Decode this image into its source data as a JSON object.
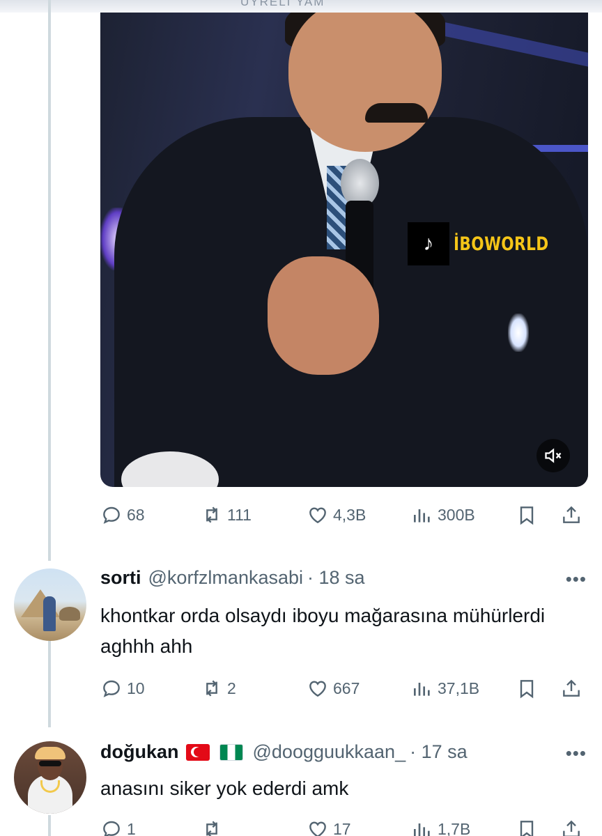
{
  "header": {
    "partial_text": "UYRELI YAM"
  },
  "video": {
    "watermark_text": "İBOWORLD",
    "watermark_icon": "tiktok-icon",
    "mute_icon": "volume-muted-icon"
  },
  "main_post": {
    "actions": {
      "replies": "68",
      "reposts": "111",
      "likes": "4,3B",
      "views": "300B"
    }
  },
  "replies": [
    {
      "name": "sorti",
      "handle": "@korfzlmankasabi",
      "time": "· 18 sa",
      "text": "khontkar orda olsaydı iboyu mağarasına mühürlerdi aghhh ahh",
      "actions": {
        "replies": "10",
        "reposts": "2",
        "likes": "667",
        "views": "37,1B"
      }
    },
    {
      "name": "doğukan",
      "flags": [
        "flag-turkey-icon",
        "flag-nigeria-icon"
      ],
      "handle": "@doogguukkaan_",
      "time": "· 17 sa",
      "text": "anasını siker yok ederdi amk",
      "actions": {
        "replies": "1",
        "reposts": "",
        "likes": "17",
        "views": "1,7B"
      }
    }
  ],
  "colors": {
    "text": "#0f1419",
    "muted": "#536471",
    "thread": "#cfd9de",
    "watermark": "#f5c518"
  }
}
